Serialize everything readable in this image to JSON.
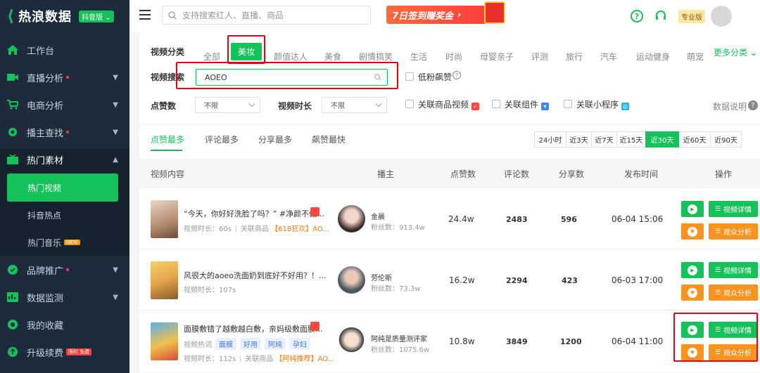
{
  "app": {
    "logo_text": "热浪数据",
    "platform_badge": "抖音版"
  },
  "sidebar": {
    "items": [
      {
        "label": "工作台"
      },
      {
        "label": "直播分析"
      },
      {
        "label": "电商分析"
      },
      {
        "label": "播主查找"
      },
      {
        "label": "热门素材"
      },
      {
        "label": "品牌推广"
      },
      {
        "label": "数据监测"
      },
      {
        "label": "我的收藏"
      },
      {
        "label": "升级续费"
      }
    ],
    "sub_items": [
      {
        "label": "热门视频"
      },
      {
        "label": "抖音热点"
      },
      {
        "label": "热门音乐",
        "tag": "NEW"
      }
    ],
    "upgrade_tag": "限时 免费"
  },
  "header": {
    "search_placeholder": "支持搜索红人、直播、商品",
    "promo_text": "7日签到赚奖金",
    "pro_label": "专业版"
  },
  "filters": {
    "category_label": "视频分类",
    "categories": [
      "全部",
      "美妆",
      "颜值达人",
      "美食",
      "剧情搞笑",
      "生活",
      "时尚",
      "母婴亲子",
      "评测",
      "旅行",
      "汽车",
      "运动健身",
      "萌宠"
    ],
    "active_category": "美妆",
    "more_label": "更多分类",
    "search_label": "视频搜索",
    "search_value": "AOEO",
    "low_fans_label": "低粉飙赞",
    "likes_label": "点赞数",
    "likes_value": "不限",
    "duration_label": "视频时长",
    "duration_value": "不限",
    "product_video_label": "关联商品视频",
    "component_label": "关联组件",
    "miniapp_label": "关联小程序",
    "help_label": "数据说明"
  },
  "tabs": [
    "点赞最多",
    "评论最多",
    "分享最多",
    "飙赞最快"
  ],
  "time_ranges": [
    "24小时",
    "近3天",
    "近7天",
    "近15天",
    "近30天",
    "近60天",
    "近90天"
  ],
  "active_time_range": "近30天",
  "table": {
    "headers": [
      "视频内容",
      "播主",
      "点赞数",
      "评论数",
      "分享数",
      "发布时间",
      "操作"
    ],
    "detail_label": "视频详情",
    "audience_label": "观众分析",
    "rows": [
      {
        "title": "“今天，你好好洗脸了吗？” #净颜不假...",
        "meta_duration_label": "视频时长：",
        "duration": "60s",
        "product_label": "关联商品",
        "product": "【618狂欢】AO...",
        "host": "金晨",
        "fans_label": "粉丝数：",
        "fans": "913.4w",
        "likes": "24.4w",
        "comments": "2483",
        "shares": "596",
        "time": "06-04 15:06"
      },
      {
        "title": "风很大的aoeo洗面奶到底好不好用？！...",
        "meta_duration_label": "视频时长：",
        "duration": "107s",
        "host": "劳伦斯",
        "fans_label": "粉丝数：",
        "fans": "73.3w",
        "likes": "16.2w",
        "comments": "2294",
        "shares": "423",
        "time": "06-03 17:00"
      },
      {
        "title": "面膜敷错了越敷越白敷，亲妈级敷面膜...",
        "keywords_label": "视频热词",
        "keywords": [
          "面膜",
          "好用",
          "阿纯",
          "孕妇"
        ],
        "meta_duration_label": "视频时长：",
        "duration": "112s",
        "product_label": "关联商品",
        "product": "【阿纯推荐】AO...",
        "host": "阿纯是质量测评家",
        "fans_label": "粉丝数：",
        "fans": "1075.6w",
        "likes": "10.8w",
        "comments": "3849",
        "shares": "1200",
        "time": "06-04 11:00"
      }
    ]
  },
  "colors": {
    "accent": "#14c259",
    "orange": "#f7931e",
    "highlight": "#e60012",
    "sidebar": "#1d2b3d"
  }
}
